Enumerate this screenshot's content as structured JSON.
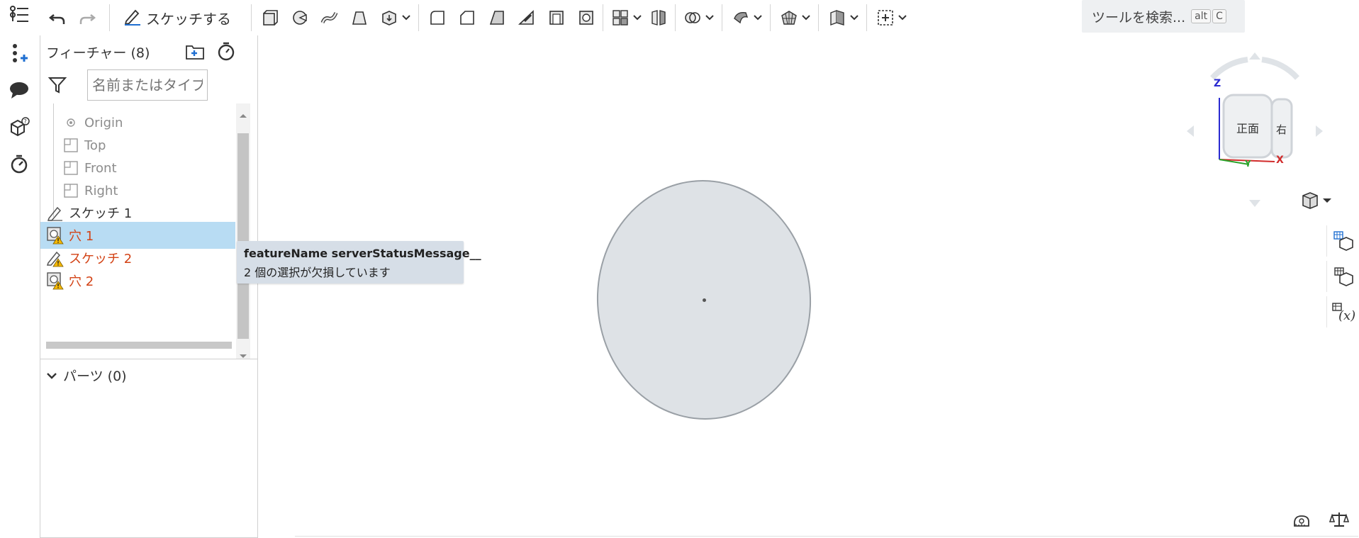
{
  "toolbar": {
    "sketch_label": "スケッチする",
    "search_label": "ツールを検索...",
    "search_key1": "alt",
    "search_key2": "C"
  },
  "left_rail": {
    "icons": [
      "feature-list-icon",
      "add-variable-icon",
      "comment-icon",
      "part-studio-help-icon",
      "performance-timer-icon"
    ]
  },
  "feature_panel": {
    "title": "フィーチャー (8)",
    "filter_placeholder": "名前またはタイプでフ",
    "tree": [
      {
        "label": "Origin",
        "kind": "origin"
      },
      {
        "label": "Top",
        "kind": "plane"
      },
      {
        "label": "Front",
        "kind": "plane"
      },
      {
        "label": "Right",
        "kind": "plane"
      },
      {
        "label": "スケッチ 1",
        "kind": "sketch"
      },
      {
        "label": "穴 1",
        "kind": "hole-error",
        "selected": true
      },
      {
        "label": "スケッチ 2",
        "kind": "sketch-error"
      },
      {
        "label": "穴 2",
        "kind": "hole-error"
      }
    ],
    "parts_label": "パーツ (0)"
  },
  "tooltip": {
    "line1": "featureName serverStatusMessage__",
    "line2": "2 個の選択が欠損しています"
  },
  "viewcube": {
    "front_label": "正面",
    "right_label": "右",
    "axis_x": "X",
    "axis_y": "Y",
    "axis_z": "Z"
  },
  "colors": {
    "error": "#d34316",
    "selection": "#b8dcf3",
    "tooltip_bg": "#d6dee7",
    "accent_blue": "#1f6fd1"
  }
}
